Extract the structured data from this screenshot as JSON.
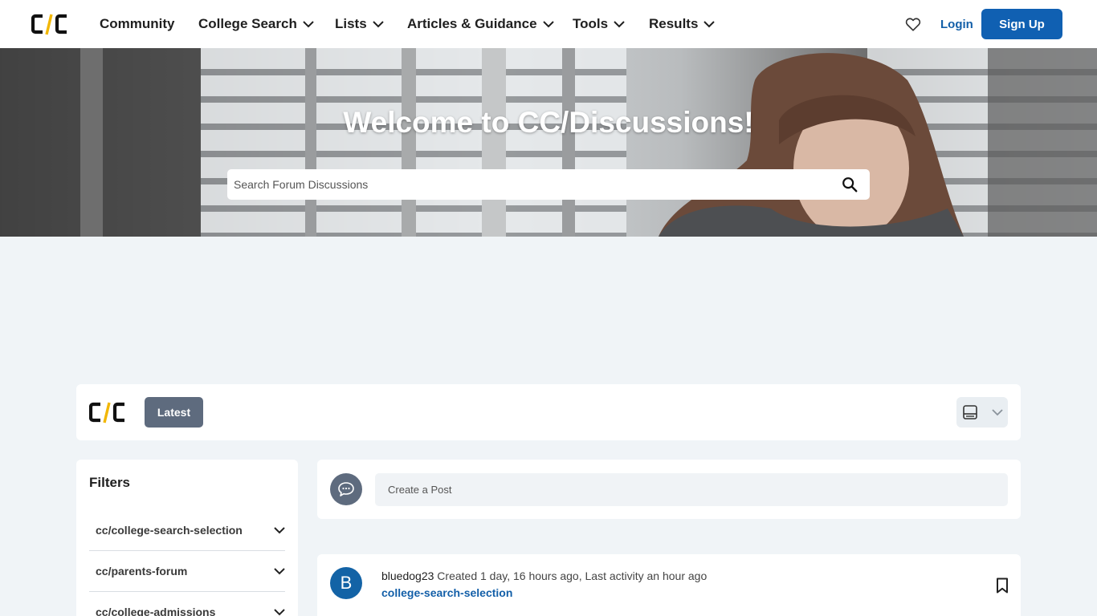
{
  "brand": {
    "logo_text": "C/C"
  },
  "nav": {
    "items": [
      {
        "label": "Community",
        "has_menu": false
      },
      {
        "label": "College Search",
        "has_menu": true
      },
      {
        "label": "Lists",
        "has_menu": true
      },
      {
        "label": "Articles & Guidance",
        "has_menu": true
      },
      {
        "label": "Tools",
        "has_menu": true
      },
      {
        "label": "Results",
        "has_menu": true
      }
    ],
    "login_label": "Login",
    "signup_label": "Sign Up"
  },
  "hero": {
    "title": "Welcome to CC/Discussions!",
    "search_placeholder": "Search Forum Discussions"
  },
  "toolbar": {
    "latest_label": "Latest"
  },
  "filters": {
    "title": "Filters",
    "items": [
      {
        "label": "cc/college-search-selection"
      },
      {
        "label": "cc/parents-forum"
      },
      {
        "label": "cc/college-admissions"
      }
    ]
  },
  "create_post": {
    "placeholder": "Create a Post"
  },
  "posts": [
    {
      "avatar_letter": "B",
      "author": "bluedog23",
      "meta": "Created 1 day, 16 hours ago, Last activity an hour ago",
      "category": "college-search-selection"
    }
  ],
  "colors": {
    "brand_blue": "#1060b2",
    "link_blue": "#135fa8",
    "accent_gold": "#f2b705",
    "page_bg": "#f0f4f7",
    "slate": "#5e6b7e"
  }
}
